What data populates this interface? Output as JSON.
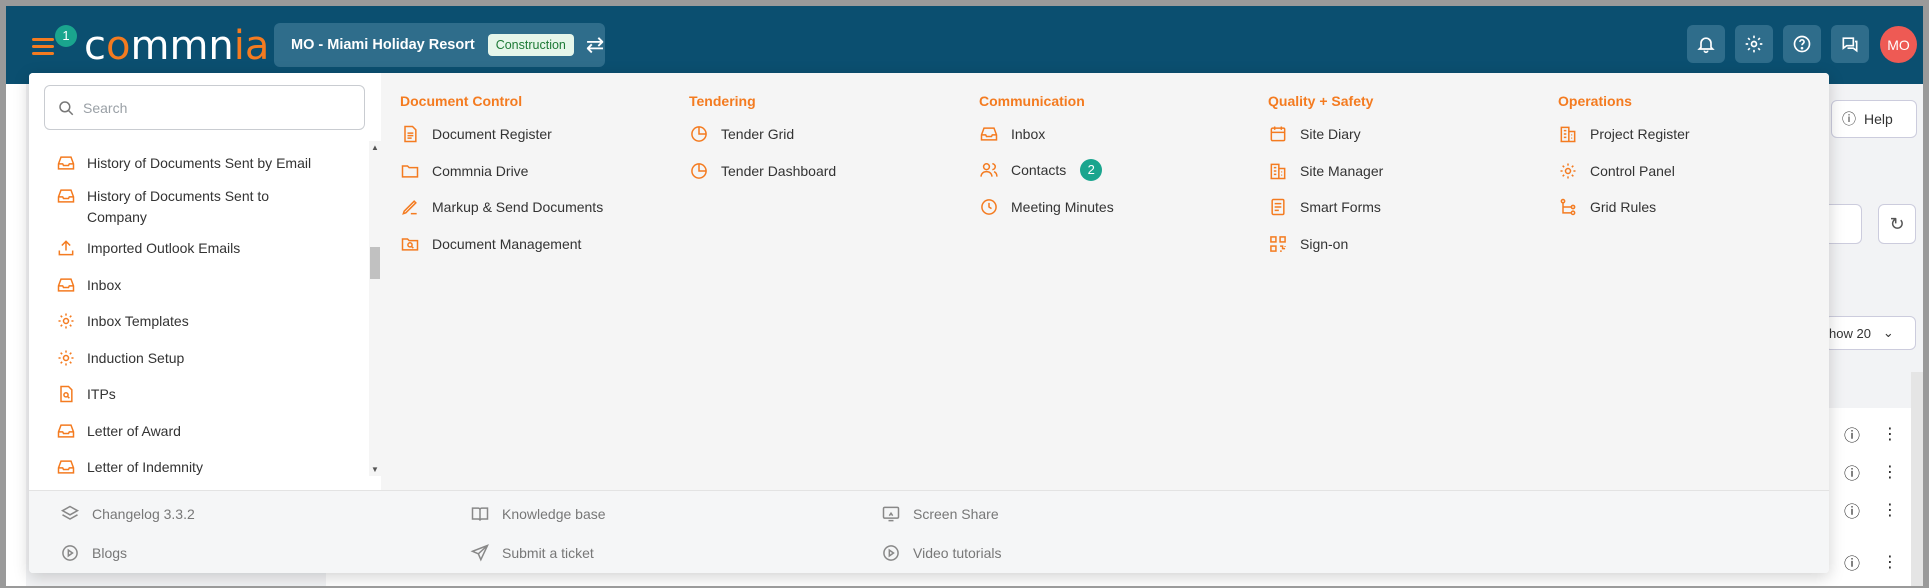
{
  "header": {
    "badge_1": "1",
    "logo_text": "commnia",
    "project_name": "MO - Miami Holiday Resort",
    "project_stage": "Construction",
    "avatar_initials": "MO"
  },
  "background": {
    "help_label": "Help",
    "show_label": "how 20"
  },
  "search": {
    "placeholder": "Search"
  },
  "sidebar": {
    "items": [
      {
        "label": "History of Documents Sent by Email",
        "icon": "inbox-icon"
      },
      {
        "label": "History of Documents Sent to Company",
        "icon": "inbox-icon"
      },
      {
        "label": "Imported Outlook Emails",
        "icon": "upload-icon"
      },
      {
        "label": "Inbox",
        "icon": "inbox-icon"
      },
      {
        "label": "Inbox Templates",
        "icon": "gear-icon"
      },
      {
        "label": "Induction Setup",
        "icon": "gear-icon"
      },
      {
        "label": "ITPs",
        "icon": "file-search-icon"
      },
      {
        "label": "Letter of Award",
        "icon": "inbox-icon"
      },
      {
        "label": "Letter of Indemnity",
        "icon": "inbox-icon"
      }
    ]
  },
  "menu": {
    "document_control": {
      "title": "Document Control",
      "items": [
        "Document Register",
        "Commnia Drive",
        "Markup & Send Documents",
        "Document Management"
      ]
    },
    "tendering": {
      "title": "Tendering",
      "items": [
        "Tender Grid",
        "Tender Dashboard"
      ]
    },
    "communication": {
      "title": "Communication",
      "items": [
        "Inbox",
        "Contacts",
        "Meeting Minutes"
      ],
      "badge_2": "2"
    },
    "quality_safety": {
      "title": "Quality + Safety",
      "items": [
        "Site Diary",
        "Site Manager",
        "Smart Forms",
        "Sign-on"
      ]
    },
    "operations": {
      "title": "Operations",
      "items": [
        "Project Register",
        "Control Panel",
        "Grid Rules"
      ]
    }
  },
  "footer": {
    "changelog": "Changelog 3.3.2",
    "blogs": "Blogs",
    "knowledge_base": "Knowledge base",
    "submit_ticket": "Submit a ticket",
    "screen_share": "Screen Share",
    "video_tutorials": "Video tutorials"
  },
  "colors": {
    "header_bg": "#0b4f70",
    "accent": "#f47b20",
    "badge": "#1aa58e",
    "avatar": "#ee5a54"
  }
}
